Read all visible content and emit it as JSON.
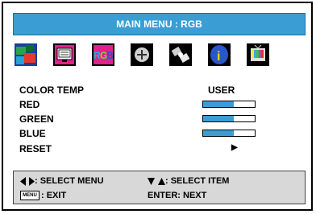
{
  "header": {
    "title": "MAIN MENU : RGB"
  },
  "icons": [
    {
      "name": "picture-icon"
    },
    {
      "name": "monitor-icon"
    },
    {
      "name": "rgb-icon",
      "label": "RGB"
    },
    {
      "name": "position-icon"
    },
    {
      "name": "satellite-icon"
    },
    {
      "name": "information-icon",
      "label": "i"
    },
    {
      "name": "tv-icon"
    }
  ],
  "menu": {
    "color_temp": {
      "label": "COLOR TEMP",
      "value": "USER"
    },
    "red": {
      "label": "RED",
      "level": 0.6
    },
    "green": {
      "label": "GREEN",
      "level": 0.6
    },
    "blue": {
      "label": "BLUE",
      "level": 0.6
    },
    "reset": {
      "label": "RESET",
      "arrow": "▶"
    }
  },
  "footer": {
    "select_menu": ": SELECT MENU",
    "select_item": ": SELECT ITEM",
    "exit": ": EXIT",
    "enter": "ENTER: NEXT",
    "menu_key": "MENU"
  },
  "colors": {
    "accent": "#3a9ed4",
    "highlight": "#e0228c"
  }
}
